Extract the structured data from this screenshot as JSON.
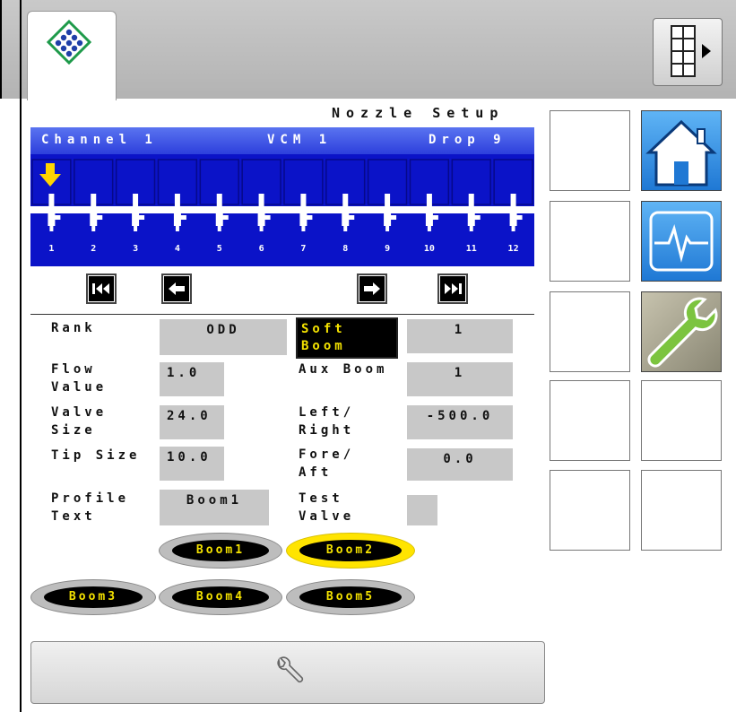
{
  "screen": {
    "title": "Nozzle Setup"
  },
  "channel": {
    "channel_label": "Channel 1",
    "vcm_label": "VCM 1",
    "drop_label": "Drop 9",
    "nozzle_numbers": [
      "1",
      "2",
      "3",
      "4",
      "5",
      "6",
      "7",
      "8",
      "9",
      "10",
      "11",
      "12"
    ],
    "selected_nozzle": "1"
  },
  "form": {
    "rank_label": "Rank",
    "rank_value": "ODD",
    "soft_boom_label": "Soft\nBoom",
    "soft_boom_value": "1",
    "flow_label": "Flow\nValue",
    "flow_value": "1.0",
    "aux_boom_label": "Aux Boom",
    "aux_boom_value": "1",
    "valve_size_label": "Valve\nSize",
    "valve_size_value": "24.0",
    "left_right_label": "Left/\nRight",
    "left_right_value": "-500.0",
    "tip_size_label": "Tip Size",
    "tip_size_value": "10.0",
    "fore_aft_label": "Fore/\nAft",
    "fore_aft_value": "0.0",
    "profile_text_label": "Profile\nText",
    "profile_text_value": "Boom1",
    "test_valve_label": "Test\nValve"
  },
  "booms": [
    "Boom1",
    "Boom2",
    "Boom3",
    "Boom4",
    "Boom5"
  ],
  "selected_boom": "Boom2",
  "icons": {
    "logo": "diamond-logo-icon",
    "menu": "grid-menu-icon",
    "home": "home-icon",
    "diagnostics": "pulse-icon",
    "setup": "wrench-icon",
    "bottom": "wrench-outline-icon"
  },
  "colors": {
    "panel_blue": "#0b13c8",
    "highlight_yellow": "#f4e200",
    "home_blue": "#2f8fe0",
    "setup_green": "#6fb83a"
  }
}
